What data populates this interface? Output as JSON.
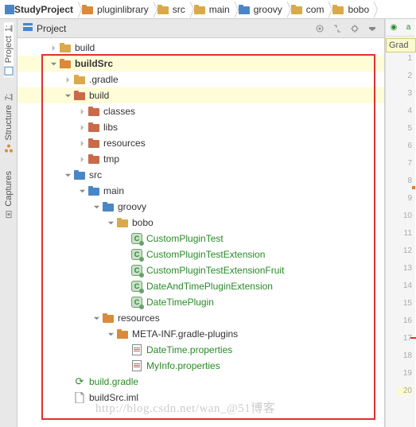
{
  "breadcrumbs": [
    {
      "icon": "module",
      "label": "StudyProject",
      "bold": true
    },
    {
      "icon": "folder-orange",
      "label": "pluginlibrary"
    },
    {
      "icon": "folder-yellow",
      "label": "src"
    },
    {
      "icon": "folder-yellow",
      "label": "main"
    },
    {
      "icon": "folder-blue",
      "label": "groovy"
    },
    {
      "icon": "folder-yellow",
      "label": "com"
    },
    {
      "icon": "folder-yellow",
      "label": "bobo"
    }
  ],
  "left_tabs": [
    {
      "num": "1",
      "label": "Project",
      "icon": "project"
    },
    {
      "num": "7",
      "label": "Structure",
      "icon": "structure"
    },
    {
      "num": "",
      "label": "Captures",
      "icon": "captures"
    }
  ],
  "panel": {
    "title": "Project"
  },
  "tree": [
    {
      "d": 0,
      "a": "right",
      "i": "folder-yellow",
      "t": "build"
    },
    {
      "d": 0,
      "a": "down",
      "i": "folder-orange",
      "t": "buildSrc",
      "bold": true,
      "hl": true
    },
    {
      "d": 1,
      "a": "right",
      "i": "folder-yellow",
      "t": ".gradle"
    },
    {
      "d": 1,
      "a": "down",
      "i": "folder-red",
      "t": "build",
      "hl": true
    },
    {
      "d": 2,
      "a": "right",
      "i": "folder-red",
      "t": "classes"
    },
    {
      "d": 2,
      "a": "right",
      "i": "folder-red",
      "t": "libs"
    },
    {
      "d": 2,
      "a": "right",
      "i": "folder-red",
      "t": "resources"
    },
    {
      "d": 2,
      "a": "right",
      "i": "folder-red",
      "t": "tmp"
    },
    {
      "d": 1,
      "a": "down",
      "i": "folder-blue",
      "t": "src"
    },
    {
      "d": 2,
      "a": "down",
      "i": "folder-blue",
      "t": "main"
    },
    {
      "d": 3,
      "a": "down",
      "i": "folder-blue",
      "t": "groovy"
    },
    {
      "d": 4,
      "a": "down",
      "i": "folder-yellow",
      "t": "bobo"
    },
    {
      "d": 5,
      "a": "",
      "i": "class",
      "t": "CustomPluginTest",
      "g": true
    },
    {
      "d": 5,
      "a": "",
      "i": "class",
      "t": "CustomPluginTestExtension",
      "g": true
    },
    {
      "d": 5,
      "a": "",
      "i": "class",
      "t": "CustomPluginTestExtensionFruit",
      "g": true
    },
    {
      "d": 5,
      "a": "",
      "i": "class",
      "t": "DateAndTimePluginExtension",
      "g": true
    },
    {
      "d": 5,
      "a": "",
      "i": "class",
      "t": "DateTimePlugin",
      "g": true
    },
    {
      "d": 3,
      "a": "down",
      "i": "folder-resources",
      "t": "resources"
    },
    {
      "d": 4,
      "a": "down",
      "i": "folder-orange",
      "t": "META-INF.gradle-plugins"
    },
    {
      "d": 5,
      "a": "",
      "i": "prop",
      "t": "DateTime.properties",
      "g": true
    },
    {
      "d": 5,
      "a": "",
      "i": "prop",
      "t": "MyInfo.properties",
      "g": true
    },
    {
      "d": 1,
      "a": "",
      "i": "gradle",
      "t": "build.gradle",
      "g": true
    },
    {
      "d": 1,
      "a": "",
      "i": "file",
      "t": "buildSrc.iml"
    }
  ],
  "gutter": {
    "tab": "Grad",
    "lines": 20,
    "top_icon": "a"
  },
  "watermark": "http://blog.csdn.net/wan_@51博客"
}
